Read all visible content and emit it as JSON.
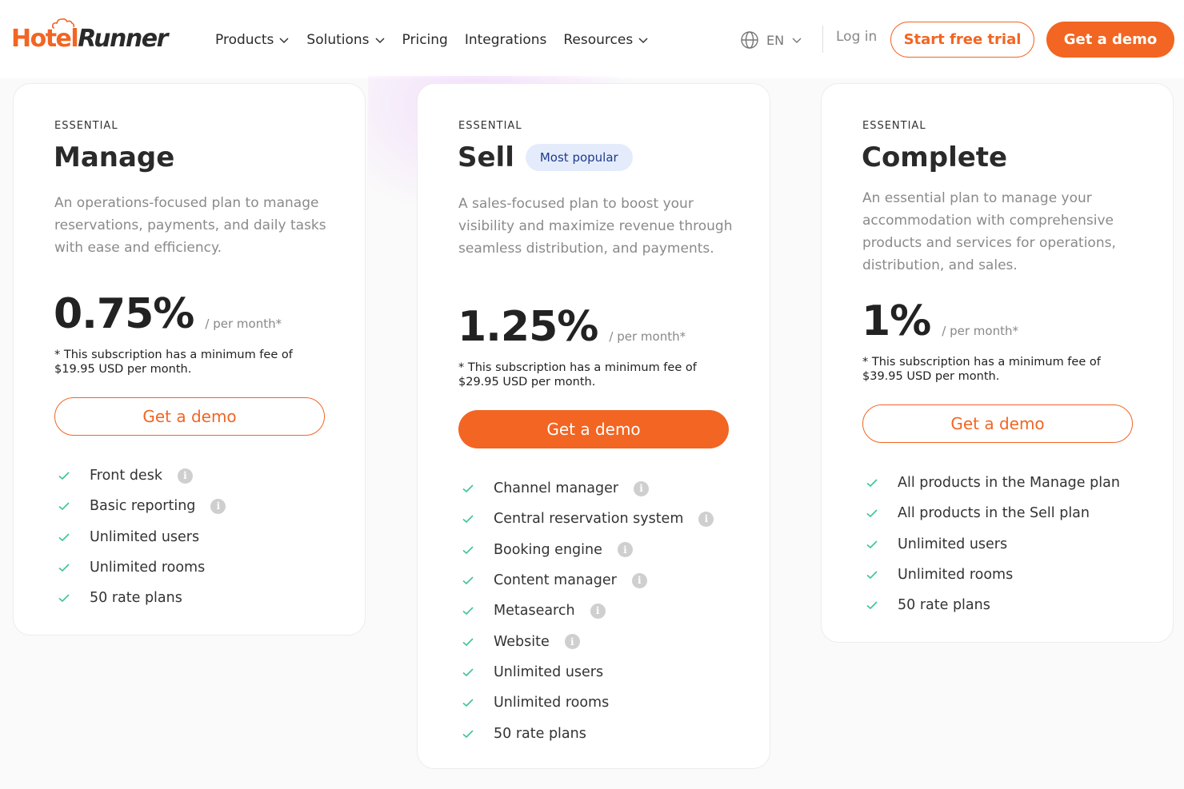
{
  "header": {
    "logo_part1": "Hotel",
    "logo_part2": "Runner",
    "nav": [
      {
        "label": "Products",
        "has_dropdown": true
      },
      {
        "label": "Solutions",
        "has_dropdown": true
      },
      {
        "label": "Pricing",
        "has_dropdown": false
      },
      {
        "label": "Integrations",
        "has_dropdown": false
      },
      {
        "label": "Resources",
        "has_dropdown": true
      }
    ],
    "language": "EN",
    "login": "Log in",
    "start_trial": "Start free trial",
    "get_demo": "Get a demo"
  },
  "colors": {
    "accent": "#f26522",
    "check": "#3cc49a",
    "badge_bg": "#e4ecfb",
    "badge_text": "#1f3b8c"
  },
  "plans": [
    {
      "tier": "ESSENTIAL",
      "name": "Manage",
      "badge": "",
      "description": "An operations-focused plan to manage reservations, payments, and daily tasks with ease and efficiency.",
      "price": "0.75%",
      "per": "/ per month*",
      "fee_note": "* This subscription has a minimum fee of $19.95 USD per month.",
      "cta": "Get a demo",
      "features": [
        {
          "label": "Front desk",
          "info": true
        },
        {
          "label": "Basic reporting",
          "info": true
        },
        {
          "label": "Unlimited users",
          "info": false
        },
        {
          "label": "Unlimited rooms",
          "info": false
        },
        {
          "label": "50 rate plans",
          "info": false
        }
      ]
    },
    {
      "tier": "ESSENTIAL",
      "name": "Sell",
      "badge": "Most popular",
      "description": "A sales-focused plan to boost your visibility and maximize revenue through seamless distribution, and payments.",
      "price": "1.25%",
      "per": "/ per month*",
      "fee_note": "* This subscription has a minimum fee of $29.95 USD per month.",
      "cta": "Get a demo",
      "features": [
        {
          "label": "Channel manager",
          "info": true
        },
        {
          "label": "Central reservation system",
          "info": true
        },
        {
          "label": "Booking engine",
          "info": true
        },
        {
          "label": "Content manager",
          "info": true
        },
        {
          "label": "Metasearch",
          "info": true
        },
        {
          "label": "Website",
          "info": true
        },
        {
          "label": "Unlimited users",
          "info": false
        },
        {
          "label": "Unlimited rooms",
          "info": false
        },
        {
          "label": "50 rate plans",
          "info": false
        }
      ]
    },
    {
      "tier": "ESSENTIAL",
      "name": "Complete",
      "badge": "",
      "description": "An essential plan to manage your accommodation with comprehensive products and services for operations, distribution, and sales.",
      "price": "1%",
      "per": "/ per month*",
      "fee_note": "* This subscription has a minimum fee of $39.95 USD per month.",
      "cta": "Get a demo",
      "features": [
        {
          "label": "All products in the Manage plan",
          "info": false
        },
        {
          "label": "All products in the Sell plan",
          "info": false
        },
        {
          "label": "Unlimited users",
          "info": false
        },
        {
          "label": "Unlimited rooms",
          "info": false
        },
        {
          "label": "50 rate plans",
          "info": false
        }
      ]
    }
  ]
}
